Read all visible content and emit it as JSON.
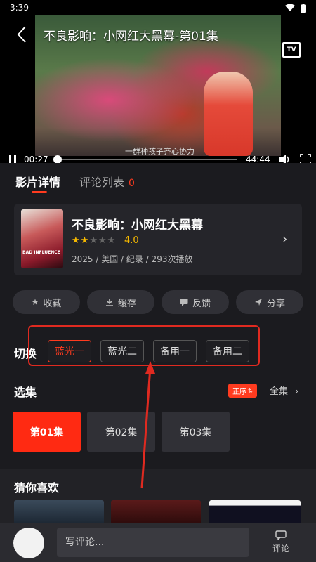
{
  "status_bar": {
    "time": "3:39"
  },
  "player": {
    "title": "不良影响：小网红大黑幕-第01集",
    "subtitle": "一群种孩子齐心协力",
    "current_time": "00:27",
    "total_time": "44:44",
    "progress": 0.01,
    "tv_label": "TV"
  },
  "tabs": [
    {
      "label": "影片详情"
    },
    {
      "label": "评论列表",
      "count": "0"
    }
  ],
  "movie": {
    "title": "不良影响：小网红大黑幕",
    "rating": "4.0",
    "stars_filled": 2,
    "stars_total": 5,
    "meta": "2025 / 美国 / 纪录 / 293次播放",
    "poster_text": "BAD INFLUENCE"
  },
  "actions": [
    {
      "label": "收藏",
      "icon": "star-icon"
    },
    {
      "label": "缓存",
      "icon": "download-icon"
    },
    {
      "label": "反馈",
      "icon": "feedback-icon"
    },
    {
      "label": "分享",
      "icon": "share-icon"
    }
  ],
  "switch": {
    "label": "切换",
    "options": [
      "蓝光一",
      "蓝光二",
      "备用一",
      "备用二"
    ],
    "selected": "蓝光一"
  },
  "episodes": {
    "label": "选集",
    "sort_label": "正序",
    "all_label": "全集",
    "items": [
      "第01集",
      "第02集",
      "第03集"
    ],
    "selected": "第01集"
  },
  "recommend": {
    "label": "猜你喜欢"
  },
  "bottom_bar": {
    "comment_placeholder": "写评论...",
    "comment_button": "评论"
  },
  "colors": {
    "accent": "#ff3b1f",
    "annotation": "#e02a20"
  }
}
